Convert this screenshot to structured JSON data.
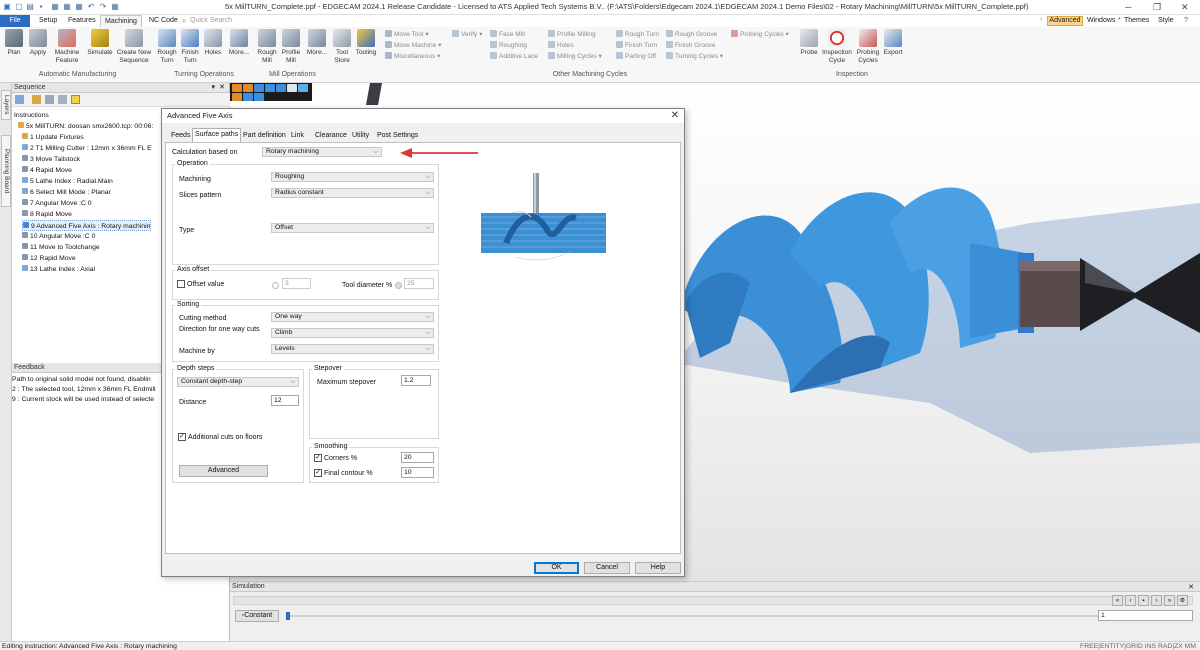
{
  "window": {
    "title": "5x MillTURN_Complete.ppf - EDGECAM 2024.1  Release Candidate - Licensed to ATS Applied Tech Systems B.V.. (F:\\ATS\\Folders\\Edgecam 2024.1\\EDGECAM 2024.1 Demo Files\\02 - Rotary Machining\\MillTURN\\5x MillTURN_Complete.ppf)"
  },
  "ribbon_tabs": [
    "File",
    "Setup",
    "Features",
    "Machining",
    "NC Code"
  ],
  "quick_search_placeholder": "Quick Search",
  "right_menu": {
    "advanced": "Advanced",
    "windows": "Windows",
    "themes": "Themes",
    "style": "Style"
  },
  "ribbon": {
    "automatic": {
      "label": "Automatic Manufacturing",
      "buttons": [
        {
          "label": "Plan",
          "icon": "plan-icon"
        },
        {
          "label": "Apply",
          "icon": "apply-icon"
        },
        {
          "label": "Machine Feature",
          "icon": "machine-feature-icon"
        },
        {
          "label": "Simulate",
          "icon": "simulate-icon"
        },
        {
          "label": "Create New Sequence",
          "icon": "new-sequence-icon"
        }
      ]
    },
    "turning": {
      "label": "Turning Operations",
      "buttons": [
        {
          "label": "Rough Turn",
          "icon": "rough-turn-icon"
        },
        {
          "label": "Finish Turn",
          "icon": "finish-turn-icon"
        },
        {
          "label": "Holes",
          "icon": "holes-icon"
        },
        {
          "label": "More...",
          "icon": "more-icon"
        }
      ]
    },
    "mill": {
      "label": "Mill Operations",
      "buttons": [
        {
          "label": "Rough Mill",
          "icon": "rough-mill-icon"
        },
        {
          "label": "Profile Mill",
          "icon": "profile-mill-icon"
        },
        {
          "label": "More...",
          "icon": "more-icon"
        }
      ]
    },
    "tools": {
      "buttons": [
        {
          "label": "Tool Store",
          "icon": "tool-store-icon"
        },
        {
          "label": "Tooling",
          "icon": "tooling-icon"
        }
      ]
    },
    "other": {
      "label": "Other Machining Cycles",
      "col1": [
        "Move Tool",
        "Move Machine",
        "Miscellaneous"
      ],
      "col2": [
        "Verify"
      ],
      "col3": [
        "Face Mill",
        "Roughing",
        "Additive Lace"
      ],
      "col4": [
        "Profile Milling",
        "Holes",
        "Milling Cycles"
      ],
      "col5": [
        "Rough Turn",
        "Finish Turn",
        "Parting Off"
      ],
      "col6": [
        "Rough Groove",
        "Finish Groove",
        "Turning Cycles"
      ],
      "col7": [
        "Probing Cycles"
      ]
    },
    "inspection": {
      "label": "Inspection",
      "buttons": [
        {
          "label": "Probe",
          "icon": "probe-icon"
        },
        {
          "label": "Inspection Cycle",
          "icon": "inspection-cycle-icon"
        },
        {
          "label": "Probing Cycles",
          "icon": "probing-cycles-icon"
        },
        {
          "label": "Export",
          "icon": "export-icon"
        }
      ]
    }
  },
  "side_tabs": [
    "Layers",
    "Planning Board"
  ],
  "sequence": {
    "title": "Sequence",
    "root": "Instructions",
    "machine": "5x MillTURN: doosan smx2600.tcp: 00:06:",
    "items": [
      "1 Update Fixtures",
      "2 T1 Milling Cutter : 12mm x 36mm FL E",
      "3 Move Tailstock",
      "4 Rapid Move",
      "5 Lathe Index : Radial.Main",
      "6 Select Mill Mode : Planar",
      "7 Angular Move :C 0",
      "8 Rapid Move",
      "9 Advanced Five Axis : Rotary machinin",
      "10 Angular Move :C 0",
      "11 Move to Toolchange",
      "12 Rapid Move",
      "13 Lathe Index : Axial"
    ],
    "selected_index": 8
  },
  "feedback": {
    "title": "Feedback",
    "lines": [
      "Path to original solid model not found, disablin",
      "2 : The selected tool, 12mm x 36mm FL Endmill",
      "9 : Current stock will be used instead of selecte"
    ]
  },
  "dialog": {
    "title": "Advanced Five Axis",
    "tabs": [
      "Feeds",
      "Surface paths",
      "Part definition",
      "Link",
      "Clearance",
      "Utility",
      "Post Settings"
    ],
    "active_tab": "Surface paths",
    "calculation_label": "Calculation based on",
    "calculation_value": "Rotary machining",
    "operation": {
      "title": "Operation",
      "machining_label": "Machining",
      "machining_value": "Roughing",
      "slices_label": "Slices pattern",
      "slices_value": "Radius constant",
      "type_label": "Type",
      "type_value": "Offset"
    },
    "axis_offset": {
      "title": "Axis offset",
      "offset_label": "Offset value",
      "offset_value": "3",
      "tool_diameter_label": "Tool diameter %",
      "tool_diameter_value": "25"
    },
    "sorting": {
      "title": "Sorting",
      "cutting_label": "Cutting method",
      "cutting_value": "One way",
      "direction_label": "Direction for one way cuts",
      "direction_value": "Climb",
      "machine_by_label": "Machine by",
      "machine_by_value": "Levels"
    },
    "depth_steps": {
      "title": "Depth steps",
      "mode_value": "Constant depth-step",
      "distance_label": "Distance",
      "distance_value": "12",
      "additional_label": "Additional cuts on floors",
      "advanced_button": "Advanced"
    },
    "stepover": {
      "title": "Stepover",
      "max_label": "Maximum stepover",
      "max_value": "1.2"
    },
    "smoothing": {
      "title": "Smoothing",
      "corners_label": "Corners %",
      "corners_value": "20",
      "final_label": "Final contour %",
      "final_value": "10"
    },
    "buttons": {
      "ok": "OK",
      "cancel": "Cancel",
      "help": "Help"
    }
  },
  "simulation": {
    "title": "Simulation",
    "mode": "Constant",
    "speed_value": "1"
  },
  "status": {
    "left": "Editing instruction:  Advanced Five Axis : Rotary machining",
    "right": "FREE|ENTITY|GRID INS RAD|ZX MM"
  },
  "colors": {
    "accent": "#2b6cc4",
    "part": "#3a8fd6",
    "arrow": "#d9383a",
    "advanced": "#fbd38a"
  }
}
